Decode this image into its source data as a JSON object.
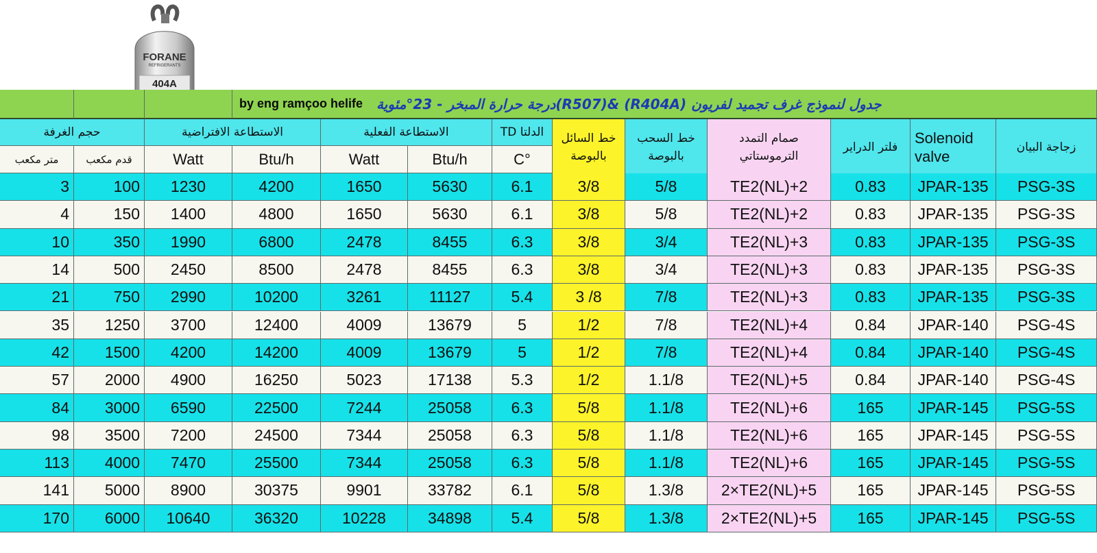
{
  "cylinder": {
    "brand": "FORANE",
    "sub": "REFRIGERANTS",
    "model": "404A"
  },
  "title": "جدول لنموذج غرف تجميد لفريون (R404A) &(R507)درجة حرارة المبخر - 23°مئوية",
  "author": "by eng ramçoo helife",
  "headers": {
    "room_volume": "حجم الغرفة",
    "nominal_capacity": "الاستطاعة الافتراضية",
    "actual_capacity": "الاستطاعة الفعلية",
    "td": "الدلتا TD",
    "liquid_line_1": "خط السائل",
    "liquid_line_2": "بالبوصة",
    "suction_line_1": "خط السحب",
    "suction_line_2": "بالبوصة",
    "txv_1": "صمام التمدد",
    "txv_2": "الترموستاتي",
    "drier": "فلتر الدراير",
    "solenoid_1": "Solenoid",
    "solenoid_2": "valve",
    "sight_glass": "زجاجة البيان"
  },
  "subheaders": {
    "cubic_meter": "متر مكعب",
    "cubic_feet": "قدم مكعب",
    "watt": "Watt",
    "btuh": "Btu/h",
    "celsius": "C°"
  },
  "rows": [
    [
      "3",
      "100",
      "1230",
      "4200",
      "1650",
      "5630",
      "6.1",
      "3/8",
      "5/8",
      "TE2(NL)+2",
      "0.83",
      "JPAR-135",
      "PSG-3S"
    ],
    [
      "4",
      "150",
      "1400",
      "4800",
      "1650",
      "5630",
      "6.1",
      "3/8",
      "5/8",
      "TE2(NL)+2",
      "0.83",
      "JPAR-135",
      "PSG-3S"
    ],
    [
      "10",
      "350",
      "1990",
      "6800",
      "2478",
      "8455",
      "6.3",
      "3/8",
      "3/4",
      "TE2(NL)+3",
      "0.83",
      "JPAR-135",
      "PSG-3S"
    ],
    [
      "14",
      "500",
      "2450",
      "8500",
      "2478",
      "8455",
      "6.3",
      "3/8",
      "3/4",
      "TE2(NL)+3",
      "0.83",
      "JPAR-135",
      "PSG-3S"
    ],
    [
      "21",
      "750",
      "2990",
      "10200",
      "3261",
      "11127",
      "5.4",
      "3 /8",
      "7/8",
      "TE2(NL)+3",
      "0.83",
      "JPAR-135",
      "PSG-3S"
    ],
    [
      "35",
      "1250",
      "3700",
      "12400",
      "4009",
      "13679",
      "5",
      "1/2",
      "7/8",
      "TE2(NL)+4",
      "0.84",
      "JPAR-140",
      "PSG-4S"
    ],
    [
      "42",
      "1500",
      "4200",
      "14200",
      "4009",
      "13679",
      "5",
      "1/2",
      "7/8",
      "TE2(NL)+4",
      "0.84",
      "JPAR-140",
      "PSG-4S"
    ],
    [
      "57",
      "2000",
      "4900",
      "16250",
      "5023",
      "17138",
      "5.3",
      "1/2",
      "1.1/8",
      "TE2(NL)+5",
      "0.84",
      "JPAR-140",
      "PSG-4S"
    ],
    [
      "84",
      "3000",
      "6590",
      "22500",
      "7244",
      "25058",
      "6.3",
      "5/8",
      "1.1/8",
      "TE2(NL)+6",
      "165",
      "JPAR-145",
      "PSG-5S"
    ],
    [
      "98",
      "3500",
      "7200",
      "24500",
      "7344",
      "25058",
      "6.3",
      "5/8",
      "1.1/8",
      "TE2(NL)+6",
      "165",
      "JPAR-145",
      "PSG-5S"
    ],
    [
      "113",
      "4000",
      "7470",
      "25500",
      "7344",
      "25058",
      "6.3",
      "5/8",
      "1.1/8",
      "TE2(NL)+6",
      "165",
      "JPAR-145",
      "PSG-5S"
    ],
    [
      "141",
      "5000",
      "8900",
      "30375",
      "9901",
      "33782",
      "6.1",
      "5/8",
      "1.3/8",
      "2×TE2(NL)+5",
      "165",
      "JPAR-145",
      "PSG-5S"
    ],
    [
      "170",
      "6000",
      "10640",
      "36320",
      "10228",
      "34898",
      "5.4",
      "5/8",
      "1.3/8",
      "2×TE2(NL)+5",
      "165",
      "JPAR-145",
      "PSG-5S"
    ]
  ],
  "colors": {
    "cyan": "#17e1e8",
    "white": "#f7f7ef",
    "yellow": "#fcf32a",
    "pink": "#f8d4f2",
    "title_green": "#8fd450",
    "title_text": "#1b3bb5"
  }
}
